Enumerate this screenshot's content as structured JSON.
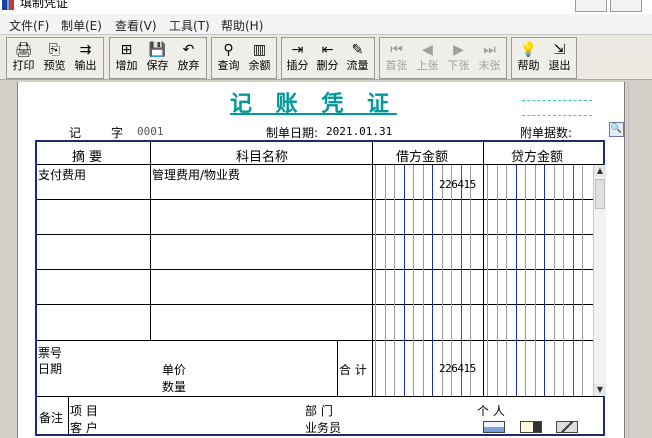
{
  "window": {
    "title": "填制凭证"
  },
  "menu": [
    "文件(F)",
    "制单(E)",
    "查看(V)",
    "工具(T)",
    "帮助(H)"
  ],
  "toolbar": {
    "print": "打印",
    "preview": "预览",
    "export": "输出",
    "add": "增加",
    "save": "保存",
    "discard": "放弃",
    "query": "查询",
    "balance": "余额",
    "insert_row": "插分",
    "delete_row": "删分",
    "cash_flow": "流量",
    "first": "首张",
    "prev": "上张",
    "next": "下张",
    "last": "末张",
    "help": "帮助",
    "exit": "退出"
  },
  "voucher": {
    "title": "记 账 凭 证",
    "type_label": "记",
    "number_label": "字",
    "number": "0001",
    "date_label": "制单日期:",
    "date": "2021.01.31",
    "attachments_label": "附单据数:",
    "columns": {
      "summary": "摘 要",
      "account": "科目名称",
      "debit": "借方金额",
      "credit": "贷方金额"
    },
    "rows": [
      {
        "summary": "支付费用",
        "account": "管理费用/物业费",
        "debit": "226415",
        "credit": ""
      },
      {
        "summary": "",
        "account": "",
        "debit": "",
        "credit": ""
      },
      {
        "summary": "",
        "account": "",
        "debit": "",
        "credit": ""
      },
      {
        "summary": "",
        "account": "",
        "debit": "",
        "credit": ""
      },
      {
        "summary": "",
        "account": "",
        "debit": "",
        "credit": ""
      }
    ],
    "footer": {
      "ticket_no": "票号",
      "date": "日期",
      "unit_price": "单价",
      "quantity": "数量",
      "total_label": "合 计",
      "total_debit": "226415",
      "total_credit": ""
    },
    "remarks": {
      "label": "备注",
      "project": "项  目",
      "customer": "客  户",
      "department": "部  门",
      "salesperson": "业务员",
      "individual": "个  人"
    }
  }
}
